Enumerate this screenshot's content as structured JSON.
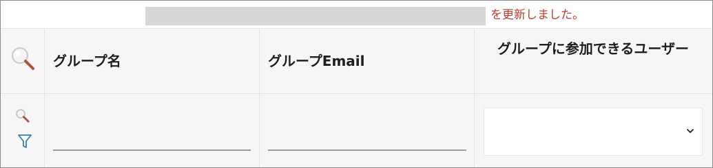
{
  "notice": {
    "message": "を更新しました。",
    "message_color": "#c0392b"
  },
  "table": {
    "columns": [
      {
        "label": "グループ名"
      },
      {
        "label": "グループEmail"
      },
      {
        "label": "グループに参加できるユーザー"
      }
    ]
  },
  "filters": {
    "group_name": {
      "value": "",
      "placeholder": ""
    },
    "group_email": {
      "value": "",
      "placeholder": ""
    },
    "users_select": {
      "selected": ""
    }
  },
  "icons": {
    "header_search": "search-icon",
    "row_search": "search-icon",
    "filter": "filter-icon",
    "dropdown": "chevron-down-icon"
  }
}
